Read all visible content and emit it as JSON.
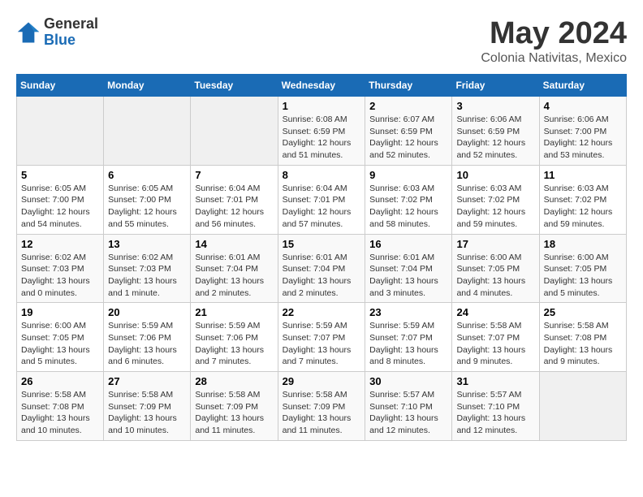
{
  "logo": {
    "general": "General",
    "blue": "Blue"
  },
  "title": "May 2024",
  "subtitle": "Colonia Nativitas, Mexico",
  "weekdays": [
    "Sunday",
    "Monday",
    "Tuesday",
    "Wednesday",
    "Thursday",
    "Friday",
    "Saturday"
  ],
  "weeks": [
    [
      {
        "day": "",
        "info": ""
      },
      {
        "day": "",
        "info": ""
      },
      {
        "day": "",
        "info": ""
      },
      {
        "day": "1",
        "info": "Sunrise: 6:08 AM\nSunset: 6:59 PM\nDaylight: 12 hours\nand 51 minutes."
      },
      {
        "day": "2",
        "info": "Sunrise: 6:07 AM\nSunset: 6:59 PM\nDaylight: 12 hours\nand 52 minutes."
      },
      {
        "day": "3",
        "info": "Sunrise: 6:06 AM\nSunset: 6:59 PM\nDaylight: 12 hours\nand 52 minutes."
      },
      {
        "day": "4",
        "info": "Sunrise: 6:06 AM\nSunset: 7:00 PM\nDaylight: 12 hours\nand 53 minutes."
      }
    ],
    [
      {
        "day": "5",
        "info": "Sunrise: 6:05 AM\nSunset: 7:00 PM\nDaylight: 12 hours\nand 54 minutes."
      },
      {
        "day": "6",
        "info": "Sunrise: 6:05 AM\nSunset: 7:00 PM\nDaylight: 12 hours\nand 55 minutes."
      },
      {
        "day": "7",
        "info": "Sunrise: 6:04 AM\nSunset: 7:01 PM\nDaylight: 12 hours\nand 56 minutes."
      },
      {
        "day": "8",
        "info": "Sunrise: 6:04 AM\nSunset: 7:01 PM\nDaylight: 12 hours\nand 57 minutes."
      },
      {
        "day": "9",
        "info": "Sunrise: 6:03 AM\nSunset: 7:02 PM\nDaylight: 12 hours\nand 58 minutes."
      },
      {
        "day": "10",
        "info": "Sunrise: 6:03 AM\nSunset: 7:02 PM\nDaylight: 12 hours\nand 59 minutes."
      },
      {
        "day": "11",
        "info": "Sunrise: 6:03 AM\nSunset: 7:02 PM\nDaylight: 12 hours\nand 59 minutes."
      }
    ],
    [
      {
        "day": "12",
        "info": "Sunrise: 6:02 AM\nSunset: 7:03 PM\nDaylight: 13 hours\nand 0 minutes."
      },
      {
        "day": "13",
        "info": "Sunrise: 6:02 AM\nSunset: 7:03 PM\nDaylight: 13 hours\nand 1 minute."
      },
      {
        "day": "14",
        "info": "Sunrise: 6:01 AM\nSunset: 7:04 PM\nDaylight: 13 hours\nand 2 minutes."
      },
      {
        "day": "15",
        "info": "Sunrise: 6:01 AM\nSunset: 7:04 PM\nDaylight: 13 hours\nand 2 minutes."
      },
      {
        "day": "16",
        "info": "Sunrise: 6:01 AM\nSunset: 7:04 PM\nDaylight: 13 hours\nand 3 minutes."
      },
      {
        "day": "17",
        "info": "Sunrise: 6:00 AM\nSunset: 7:05 PM\nDaylight: 13 hours\nand 4 minutes."
      },
      {
        "day": "18",
        "info": "Sunrise: 6:00 AM\nSunset: 7:05 PM\nDaylight: 13 hours\nand 5 minutes."
      }
    ],
    [
      {
        "day": "19",
        "info": "Sunrise: 6:00 AM\nSunset: 7:05 PM\nDaylight: 13 hours\nand 5 minutes."
      },
      {
        "day": "20",
        "info": "Sunrise: 5:59 AM\nSunset: 7:06 PM\nDaylight: 13 hours\nand 6 minutes."
      },
      {
        "day": "21",
        "info": "Sunrise: 5:59 AM\nSunset: 7:06 PM\nDaylight: 13 hours\nand 7 minutes."
      },
      {
        "day": "22",
        "info": "Sunrise: 5:59 AM\nSunset: 7:07 PM\nDaylight: 13 hours\nand 7 minutes."
      },
      {
        "day": "23",
        "info": "Sunrise: 5:59 AM\nSunset: 7:07 PM\nDaylight: 13 hours\nand 8 minutes."
      },
      {
        "day": "24",
        "info": "Sunrise: 5:58 AM\nSunset: 7:07 PM\nDaylight: 13 hours\nand 9 minutes."
      },
      {
        "day": "25",
        "info": "Sunrise: 5:58 AM\nSunset: 7:08 PM\nDaylight: 13 hours\nand 9 minutes."
      }
    ],
    [
      {
        "day": "26",
        "info": "Sunrise: 5:58 AM\nSunset: 7:08 PM\nDaylight: 13 hours\nand 10 minutes."
      },
      {
        "day": "27",
        "info": "Sunrise: 5:58 AM\nSunset: 7:09 PM\nDaylight: 13 hours\nand 10 minutes."
      },
      {
        "day": "28",
        "info": "Sunrise: 5:58 AM\nSunset: 7:09 PM\nDaylight: 13 hours\nand 11 minutes."
      },
      {
        "day": "29",
        "info": "Sunrise: 5:58 AM\nSunset: 7:09 PM\nDaylight: 13 hours\nand 11 minutes."
      },
      {
        "day": "30",
        "info": "Sunrise: 5:57 AM\nSunset: 7:10 PM\nDaylight: 13 hours\nand 12 minutes."
      },
      {
        "day": "31",
        "info": "Sunrise: 5:57 AM\nSunset: 7:10 PM\nDaylight: 13 hours\nand 12 minutes."
      },
      {
        "day": "",
        "info": ""
      }
    ]
  ]
}
